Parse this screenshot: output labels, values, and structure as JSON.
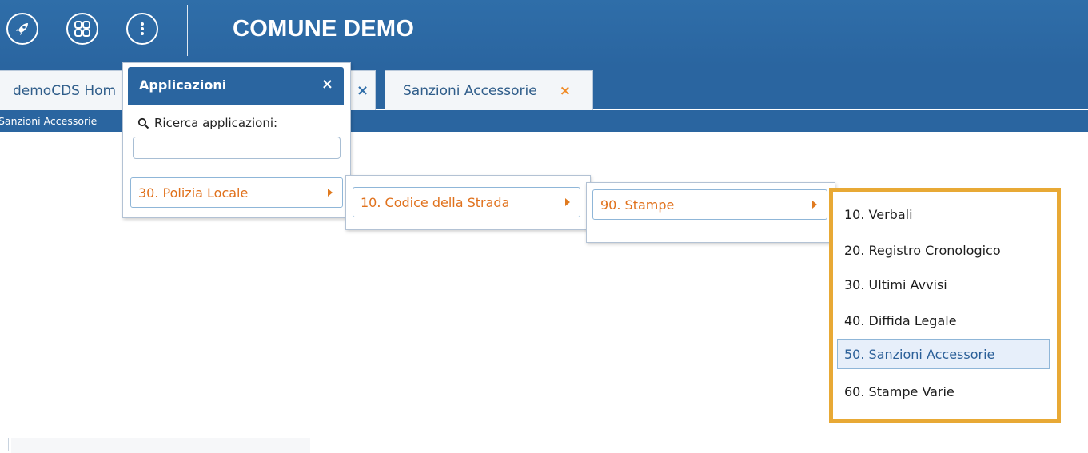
{
  "header": {
    "title": "COMUNE DEMO",
    "icons": [
      "rocket-icon",
      "apps-grid-icon",
      "more-vertical-icon"
    ]
  },
  "tabs": [
    {
      "label": "demoCDS Hom",
      "close": "×"
    },
    {
      "label": "Sanzioni Accessorie",
      "close": "×"
    }
  ],
  "breadcrumb": "Sanzioni Accessorie",
  "apps_menu": {
    "title": "Applicazioni",
    "close": "×",
    "search_label": "Ricerca applicazioni:",
    "search_value": "",
    "item": "30. Polizia Locale"
  },
  "submenu_1": {
    "item": "10. Codice della Strada"
  },
  "submenu_2": {
    "item": "90. Stampe"
  },
  "submenu_3": {
    "items": [
      {
        "label": "10. Verbali"
      },
      {
        "label": "20. Registro Cronologico"
      },
      {
        "label": "30. Ultimi Avvisi"
      },
      {
        "label": "40. Diffida Legale"
      },
      {
        "label": "50. Sanzioni Accessorie"
      },
      {
        "label": "60. Stampe Varie"
      }
    ],
    "active_index": 4
  },
  "colors": {
    "header_blue": "#2a65a0",
    "menu_text_orange": "#e0711c",
    "highlight_box": "#e8a935",
    "tab_close_orange": "#f08a24"
  }
}
